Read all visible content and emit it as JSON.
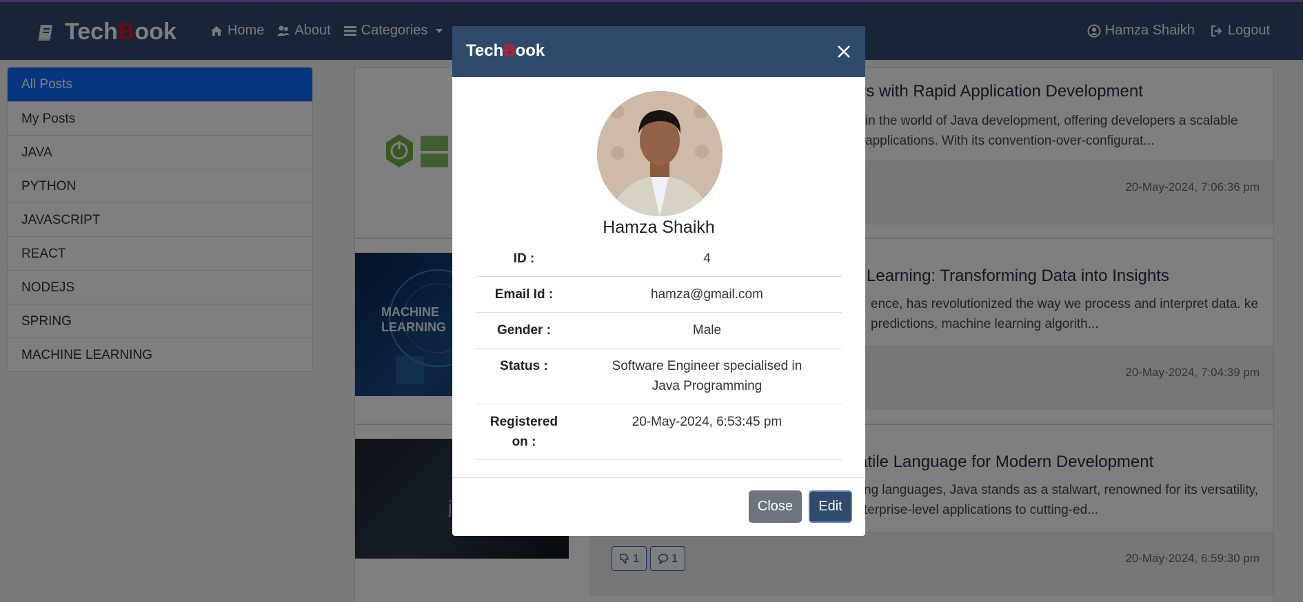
{
  "navbar": {
    "brand_prefix": "Tech",
    "brand_b": "B",
    "brand_suffix": "ook",
    "links": [
      {
        "label": "Home",
        "icon": "home-icon"
      },
      {
        "label": "About",
        "icon": "users-icon"
      },
      {
        "label": "Categories",
        "icon": "list-icon"
      }
    ],
    "user_label": "Hamza Shaikh",
    "logout_label": "Logout"
  },
  "sidebar": {
    "items": [
      "All Posts",
      "My Posts",
      "JAVA",
      "PYTHON",
      "JAVASCRIPT",
      "REACT",
      "NODEJS",
      "SPRING",
      "MACHINE LEARNING"
    ],
    "active": "All Posts"
  },
  "posts": [
    {
      "title": "ers with Rapid Application Development",
      "excerpt": " in the world of Java development, offering developers a scalable applications. With its convention-over-configurat...",
      "date": "20-May-2024, 7:06:36 pm"
    },
    {
      "title": "Learning: Transforming Data into Insights",
      "excerpt": "ence, has revolutionized the way we process and interpret data. ke predictions, machine learning algorith...",
      "date": "20-May-2024, 7:04:39 pm"
    },
    {
      "title": "atile Language for Modern Development",
      "excerpt": "ng languages, Java stands as a stalwart, renowned for its versatility, terprise-level applications to cutting-ed...",
      "date": "20-May-2024, 6:59:30 pm",
      "dislike_count": "1",
      "comment_count": "1"
    }
  ],
  "modal": {
    "brand_prefix": "Tech",
    "brand_b": "B",
    "brand_suffix": "ook",
    "user_name": "Hamza Shaikh",
    "rows": [
      {
        "key": "ID :",
        "value": "4"
      },
      {
        "key": "Email Id :",
        "value": "hamza@gmail.com"
      },
      {
        "key": "Gender :",
        "value": "Male"
      },
      {
        "key": "Status :",
        "value": "Software Engineer specialised in Java Programming"
      },
      {
        "key": "Registered on :",
        "value": "20-May-2024, 6:53:45 pm"
      }
    ],
    "close_label": "Close",
    "edit_label": "Edit"
  },
  "colors": {
    "navbar": "#2f4a6d",
    "accent": "#0d6efd",
    "brand_b": "#e0141c"
  }
}
